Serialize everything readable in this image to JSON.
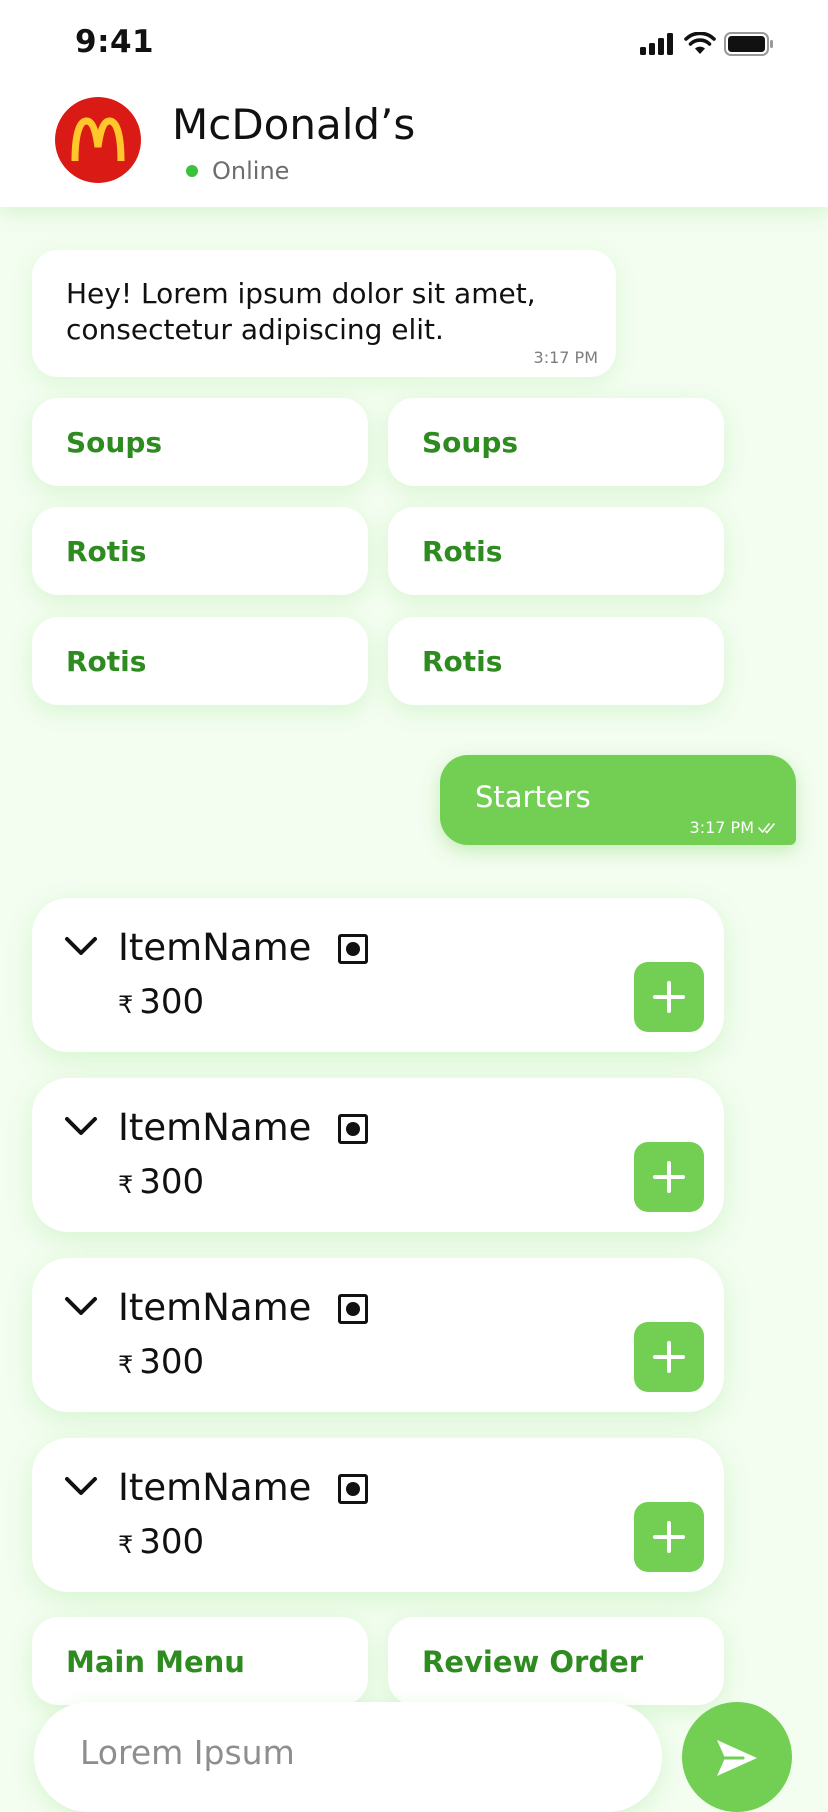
{
  "status_bar": {
    "time": "9:41",
    "signal_icon": "cellular-signal-icon",
    "wifi_icon": "wifi-icon",
    "battery_icon": "battery-icon"
  },
  "header": {
    "logo_icon": "mcdonalds-logo-icon",
    "title": "McDonald’s",
    "status": "Online",
    "status_color": "#3cc23a"
  },
  "messages": {
    "incoming": {
      "text": "Hey! Lorem ipsum dolor sit amet,\nconsectetur adipiscing elit.",
      "time": "3:17 PM"
    },
    "outgoing": {
      "text": "Starters",
      "time": "3:17 PM",
      "read_icon": "double-check-icon"
    }
  },
  "options": [
    {
      "label": "Soups"
    },
    {
      "label": "Soups"
    },
    {
      "label": "Rotis"
    },
    {
      "label": "Rotis"
    },
    {
      "label": "Rotis"
    },
    {
      "label": "Rotis"
    }
  ],
  "items": [
    {
      "name": "ItemName",
      "currency": "₹",
      "price": "300"
    },
    {
      "name": "ItemName",
      "currency": "₹",
      "price": "300"
    },
    {
      "name": "ItemName",
      "currency": "₹",
      "price": "300"
    },
    {
      "name": "ItemName",
      "currency": "₹",
      "price": "300"
    }
  ],
  "quick_replies": {
    "main_menu": "Main Menu",
    "review_order": "Review Order"
  },
  "input": {
    "placeholder": "Lorem Ipsum",
    "value": ""
  },
  "colors": {
    "accent": "#72cf53",
    "option_text": "#2e8b1f",
    "background": "#f3fdf0",
    "logo_red": "#da1b15",
    "logo_yellow": "#ffc72c"
  }
}
